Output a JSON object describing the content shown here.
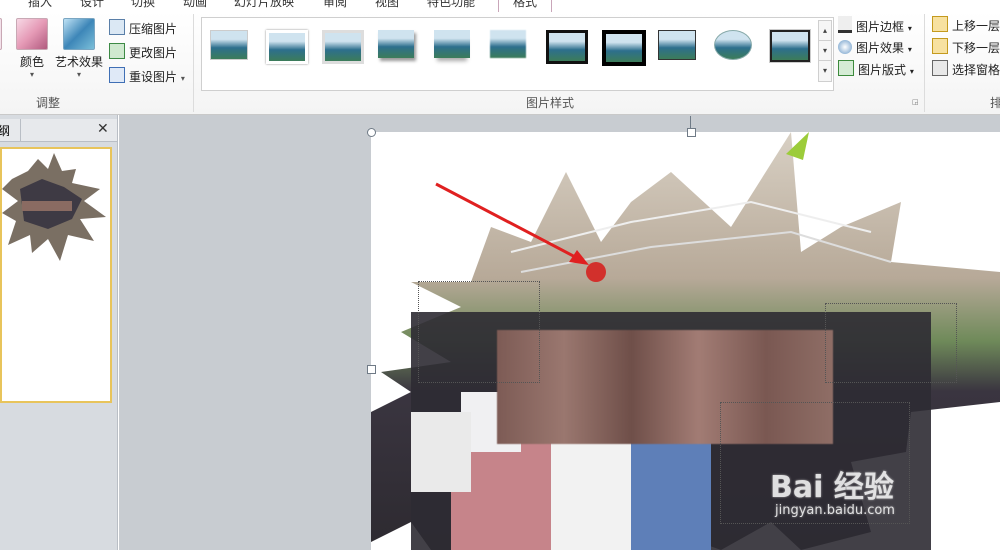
{
  "tabs": [
    "插入",
    "设计",
    "切换",
    "动画",
    "幻灯片放映",
    "审阅",
    "视图",
    "特色功能",
    "格式"
  ],
  "ribbon": {
    "adjust": {
      "color_label": "颜色",
      "art_effects_label": "艺术效果",
      "compress_label": "压缩图片",
      "change_label": "更改图片",
      "reset_label": "重设图片",
      "group_label": "调整"
    },
    "styles": {
      "border_label": "图片边框",
      "effects_label": "图片效果",
      "layout_label": "图片版式",
      "group_label": "图片样式"
    },
    "arrange": {
      "bring_forward_label": "上移一层",
      "send_backward_label": "下移一层",
      "selection_pane_label": "选择窗格",
      "group_label": "排"
    }
  },
  "left_pane": {
    "tab_label": "纲",
    "close_glyph": "✕"
  },
  "watermark": {
    "text": "Bai  经验",
    "sub": "jingyan.baidu.com"
  },
  "colors": {
    "accent": "#c9a6b9",
    "selected_thumb_border": "#e8c45b",
    "annotation_arrow": "#e02020"
  }
}
